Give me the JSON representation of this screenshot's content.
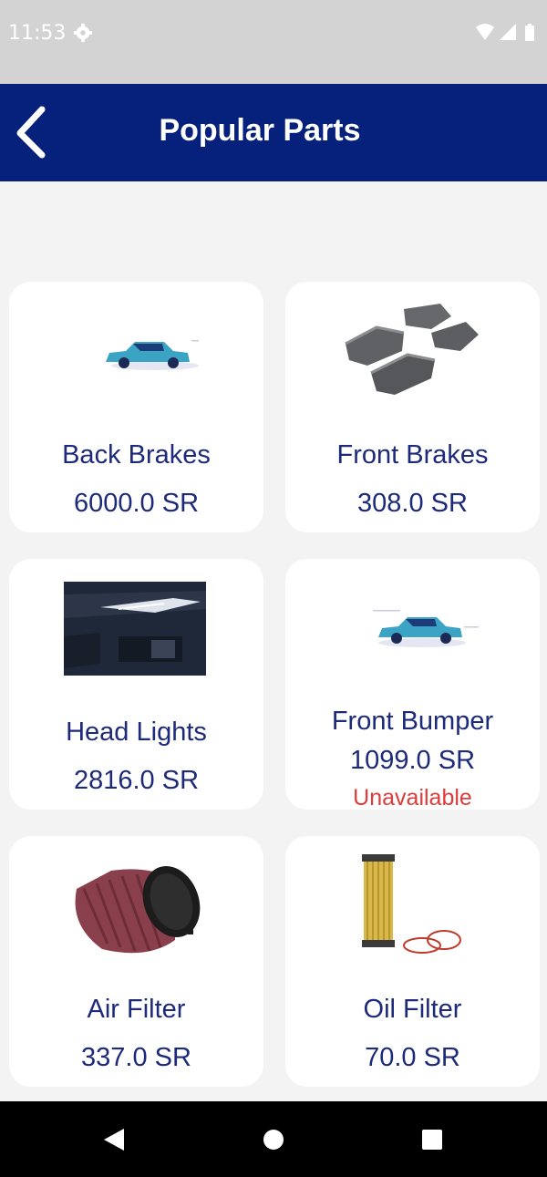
{
  "status_bar": {
    "time": "11:53",
    "icons": [
      "gear-icon",
      "wifi-icon",
      "signal-icon",
      "battery-icon"
    ]
  },
  "header": {
    "title": "Popular Parts",
    "back_icon": "chevron-left-icon"
  },
  "products": [
    {
      "name": "Back Brakes",
      "price": "6000.0 SR",
      "status": "",
      "image": "car-placeholder"
    },
    {
      "name": "Front Brakes",
      "price": "308.0 SR",
      "status": "",
      "image": "brake-pads"
    },
    {
      "name": "Head Lights",
      "price": "2816.0 SR",
      "status": "",
      "image": "headlight"
    },
    {
      "name": "Front Bumper",
      "price": "1099.0 SR",
      "status": "Unavailable",
      "image": "car-placeholder"
    },
    {
      "name": "Air Filter",
      "price": "337.0 SR",
      "status": "",
      "image": "air-filter"
    },
    {
      "name": "Oil Filter",
      "price": "70.0 SR",
      "status": "",
      "image": "oil-filter"
    }
  ],
  "nav": {
    "back": "back-triangle-icon",
    "home": "home-circle-icon",
    "recents": "recents-square-icon"
  },
  "colors": {
    "app_bar": "#05217c",
    "text": "#1d2a7a",
    "unavailable": "#e03b3b",
    "background": "#f3f3f3"
  }
}
